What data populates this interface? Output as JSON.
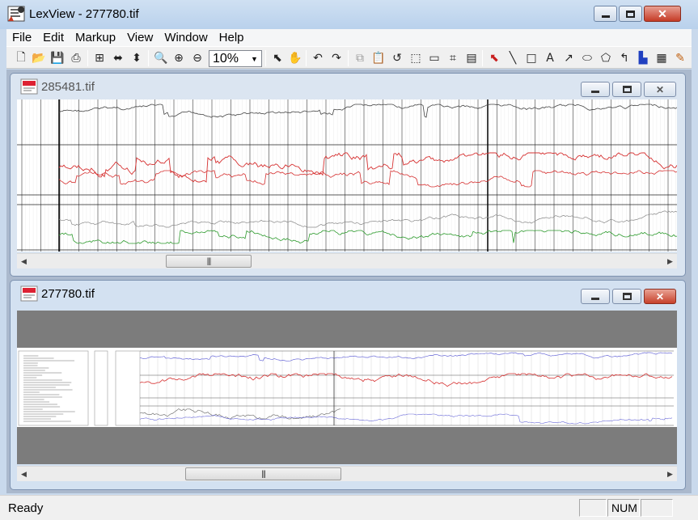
{
  "app": {
    "title": "LexView - 277780.tif"
  },
  "menu": [
    "File",
    "Edit",
    "Markup",
    "View",
    "Window",
    "Help"
  ],
  "toolbar": {
    "zoom": "10%",
    "icons": [
      "new-icon",
      "open-icon",
      "save-icon",
      "print-icon",
      "fit-page-icon",
      "fit-width-icon",
      "fit-height-icon",
      "zoom-area-icon",
      "zoom-in-icon",
      "zoom-out-icon",
      "select-icon",
      "pan-hand-icon",
      "rotate-left-icon",
      "rotate-right-icon",
      "copy-icon",
      "paste-icon",
      "undo-icon",
      "select-rect-icon",
      "select-all-icon",
      "crop-icon",
      "stamp-icon",
      "pointer-arrow-icon",
      "line-icon",
      "rectangle-icon",
      "text-icon",
      "arrow-icon",
      "ellipse-icon",
      "polygon-icon",
      "freehand-icon",
      "highlight-icon",
      "note-icon",
      "pen-icon"
    ]
  },
  "windows": [
    {
      "title": "285481.tif",
      "state": "inactive"
    },
    {
      "title": "277780.tif",
      "state": "active"
    }
  ],
  "status": {
    "text": "Ready",
    "num": "NUM"
  },
  "colors": {
    "accent_close": "#c7412b",
    "log_red": "#d63030",
    "log_green": "#2c9a2c",
    "log_blue": "#6a6ad8"
  }
}
